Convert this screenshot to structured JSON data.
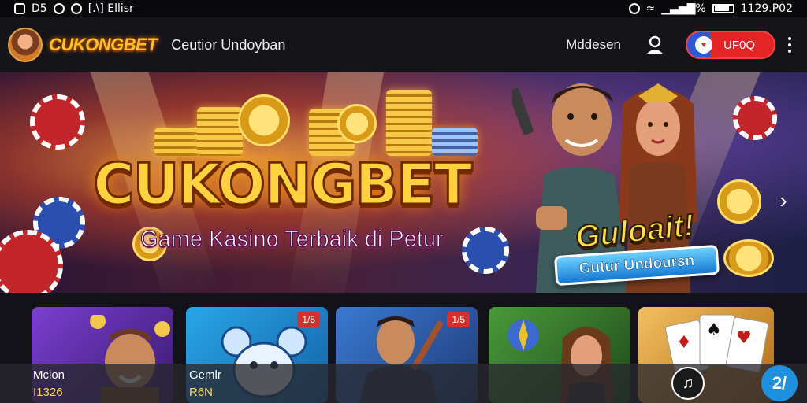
{
  "statusbar": {
    "left_text": "D5",
    "left_extra": "[.\\] Ellisr",
    "right_signal": "▁▃▅▇%",
    "right_time": "1129.P02"
  },
  "appbar": {
    "brand": "CUKONGBET",
    "title": "Ceutior Undoyban",
    "link": "Mddesen",
    "pill_icon_text": "♥",
    "pill_label": "UF0Q"
  },
  "hero": {
    "title": "CUKONGBET",
    "subtitle": "Game Kasino Terbaik di Petur",
    "shout": "Guloait!",
    "cta": "Gutur Undoursn",
    "next_glyph": "›"
  },
  "games": {
    "cards": [
      {
        "badge": "",
        "label": "Mcion",
        "sublabel": "I1326",
        "accent": "#6b2fb0"
      },
      {
        "badge": "1/5",
        "label": "Gemlr",
        "sublabel": "R6N",
        "accent": "#1f8fcf"
      },
      {
        "badge": "1/5",
        "label": "",
        "sublabel": "",
        "accent": "#2a5fb8"
      },
      {
        "badge": "",
        "label": "",
        "sublabel": "",
        "accent": "#3a7a2a"
      },
      {
        "badge": "",
        "label": "",
        "sublabel": "",
        "accent": "#e2a030"
      }
    ],
    "music_glyph": "♫",
    "help_text": "2/"
  },
  "colors": {
    "brand": "#ffc21a",
    "cta": "#1779d2",
    "pill": "#e32525"
  }
}
